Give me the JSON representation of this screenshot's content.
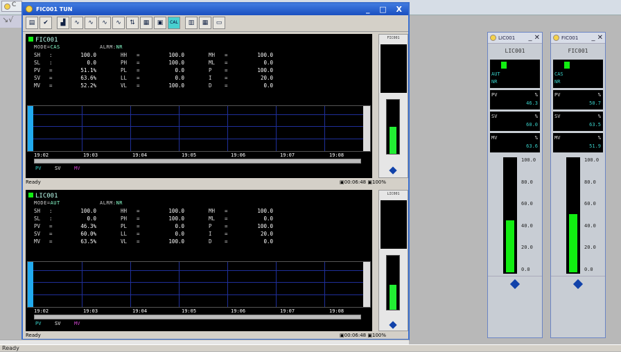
{
  "app": {
    "topstrip_tab": "C",
    "status": "Ready"
  },
  "window": {
    "title": "FIC001 TUN",
    "controls": "_ □ X",
    "toolbar": [
      {
        "name": "print-icon",
        "glyph": "▤"
      },
      {
        "name": "check-icon",
        "glyph": "✔"
      },
      {
        "name": "trend-icon",
        "glyph": "▟"
      },
      {
        "name": "wave-icon",
        "glyph": "∿"
      },
      {
        "name": "wave2-icon",
        "glyph": "∿"
      },
      {
        "name": "wave3-icon",
        "glyph": "∿"
      },
      {
        "name": "wave4-icon",
        "glyph": "∿"
      },
      {
        "name": "tune-icon",
        "glyph": "⇅"
      },
      {
        "name": "faceplate-icon",
        "glyph": "▦"
      },
      {
        "name": "edit-icon",
        "glyph": "▣"
      },
      {
        "name": "cal-icon",
        "glyph": "CAL"
      },
      {
        "name": "bars-icon",
        "glyph": "▥"
      },
      {
        "name": "faceplate2-icon",
        "glyph": "▦"
      },
      {
        "name": "save-icon",
        "glyph": "▭"
      }
    ]
  },
  "panel1": {
    "tag": "FIC001",
    "mode_label": "MODE=",
    "mode": "CAS",
    "alarm_label": "ALRM:",
    "alarm": "NR",
    "rows": [
      [
        "SH",
        ":",
        "100.0",
        "HH",
        "=",
        "100.0",
        "MH",
        "=",
        "100.0"
      ],
      [
        "SL",
        ":",
        "0.0",
        "PH",
        "=",
        "100.0",
        "ML",
        "=",
        "0.0"
      ],
      [
        "PV",
        "=",
        "51.1%",
        "PL",
        "=",
        "0.0",
        "P",
        "=",
        "100.0"
      ],
      [
        "SV",
        "=",
        "63.6%",
        "LL",
        "=",
        "0.0",
        "I",
        "=",
        "20.0"
      ],
      [
        "MV",
        "=",
        "52.2%",
        "VL",
        "=",
        "100.0",
        "D",
        "=",
        "0.0"
      ]
    ],
    "times": [
      "19:02",
      "19:03",
      "19:04",
      "19:05",
      "19:06",
      "19:07",
      "19:08"
    ],
    "legend": [
      "PV",
      "SV",
      "MV"
    ],
    "legend_colors": [
      "#39d0c9",
      "#ffffff",
      "#cc44cc"
    ],
    "side_tag": "FIC001",
    "side_fill_percent": 50,
    "status_left": "Ready",
    "status_time": "00:06:48",
    "status_zoom": "100%"
  },
  "panel2": {
    "tag": "LIC001",
    "mode_label": "MODE=",
    "mode": "AUT",
    "alarm_label": "ALRM:",
    "alarm": "NR",
    "rows": [
      [
        "SH",
        ":",
        "100.0",
        "HH",
        "=",
        "100.0",
        "MH",
        "=",
        "100.0"
      ],
      [
        "SL",
        ":",
        "0.0",
        "PH",
        "=",
        "100.0",
        "ML",
        "=",
        "0.0"
      ],
      [
        "PV",
        "=",
        "46.3%",
        "PL",
        "=",
        "0.0",
        "P",
        "=",
        "100.0"
      ],
      [
        "SV",
        "=",
        "60.0%",
        "LL",
        "=",
        "0.0",
        "I",
        "=",
        "20.0"
      ],
      [
        "MV",
        "=",
        "63.5%",
        "VL",
        "=",
        "100.0",
        "D",
        "=",
        "0.0"
      ]
    ],
    "times": [
      "19:02",
      "19:03",
      "19:04",
      "19:05",
      "19:06",
      "19:07",
      "19:08"
    ],
    "legend": [
      "PV",
      "SV",
      "MV"
    ],
    "legend_colors": [
      "#39d0c9",
      "#ffffff",
      "#cc44cc"
    ],
    "side_tag": "LIC001",
    "side_fill_percent": 46,
    "status_left": "Ready",
    "status_time": "00:06:48",
    "status_zoom": "100%"
  },
  "face1": {
    "title": "LIC001",
    "tag": "LIC001",
    "mode": "AUT",
    "alarm": "NR",
    "pv_label": "PV",
    "pv_unit": "%",
    "pv": "46.3",
    "sv_label": "SV",
    "sv_unit": "%",
    "sv": "60.0",
    "mv_label": "MV",
    "mv_unit": "%",
    "mv": "63.6",
    "scale": [
      "100.0",
      "80.0",
      "60.0",
      "40.0",
      "20.0",
      "0.0"
    ],
    "fill_percent": 46
  },
  "face2": {
    "title": "FIC001",
    "tag": "FIC001",
    "mode": "CAS",
    "alarm": "NR",
    "pv_label": "PV",
    "pv_unit": "%",
    "pv": "50.7",
    "sv_label": "SV",
    "sv_unit": "%",
    "sv": "63.5",
    "mv_label": "MV",
    "mv_unit": "%",
    "mv": "51.9",
    "scale": [
      "100.0",
      "80.0",
      "60.0",
      "40.0",
      "20.0",
      "0.0"
    ],
    "fill_percent": 51
  }
}
